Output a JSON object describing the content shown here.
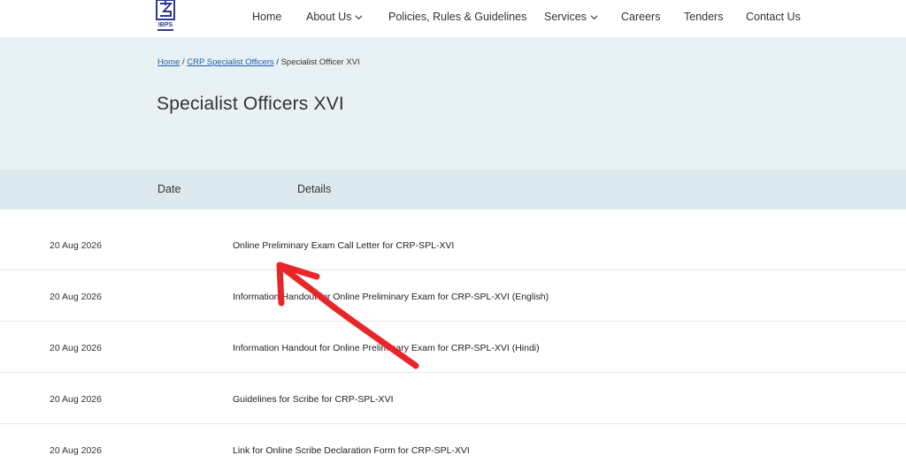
{
  "header": {
    "logo_text": "IBPS",
    "nav": [
      {
        "label": "Home",
        "dropdown": false
      },
      {
        "label": "About Us",
        "dropdown": true
      },
      {
        "label": "Policies, Rules & Guidelines",
        "dropdown": false
      },
      {
        "label": "Services",
        "dropdown": true
      },
      {
        "label": "Careers",
        "dropdown": false
      },
      {
        "label": "Tenders",
        "dropdown": false
      },
      {
        "label": "Contact Us",
        "dropdown": false
      }
    ]
  },
  "breadcrumb": {
    "home": "Home",
    "section": "CRP Specialist Officers",
    "separator": "/",
    "current": "Specialist Officer XVI"
  },
  "page": {
    "title": "Specialist Officers XVI"
  },
  "table": {
    "headers": {
      "date": "Date",
      "details": "Details"
    },
    "rows": [
      {
        "date": "20 Aug 2026",
        "details": "Online Preliminary Exam Call Letter for CRP-SPL-XVI"
      },
      {
        "date": "20 Aug 2026",
        "details": "Information Handout for Online Preliminary Exam for CRP-SPL-XVI (English)"
      },
      {
        "date": "20 Aug 2026",
        "details": "Information Handout for Online Preliminary Exam for CRP-SPL-XVI (Hindi)"
      },
      {
        "date": "20 Aug 2026",
        "details": "Guidelines for Scribe for CRP-SPL-XVI"
      },
      {
        "date": "20 Aug 2026",
        "details": "Link for Online Scribe Declaration Form for CRP-SPL-XVI"
      }
    ]
  },
  "colors": {
    "hero_bg": "#e8f1f4",
    "table_header_bg": "#dce9ef",
    "link": "#1e5fa8",
    "logo": "#2b3990",
    "annotation": "#e8262a"
  },
  "icons": {
    "logo": "ibps-logo-icon",
    "dropdown": "chevron-down-icon"
  }
}
